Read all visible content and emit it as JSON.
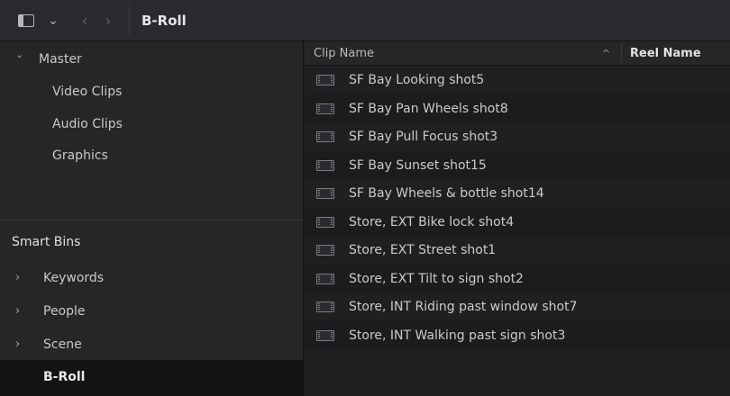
{
  "toolbar": {
    "panel_icon": "sidebar-panel-icon",
    "dropdown_icon": "chevron-down-icon",
    "back_glyph": "‹",
    "forward_glyph": "›",
    "dropdown_glyph": "⌄",
    "bin_title": "B-Roll"
  },
  "sidebar": {
    "master": {
      "label": "Master",
      "caret": "⌄",
      "children": [
        "Video Clips",
        "Audio Clips",
        "Graphics"
      ]
    },
    "smart_bins_title": "Smart Bins",
    "smart_bins": [
      {
        "label": "Keywords",
        "chevron": "›"
      },
      {
        "label": "People",
        "chevron": "›"
      },
      {
        "label": "Scene",
        "chevron": "›"
      }
    ],
    "selected_bin": "B-Roll"
  },
  "clip_list": {
    "columns": {
      "clip_name": "Clip Name",
      "sort_indicator": "^",
      "reel_name": "Reel Name"
    },
    "clips": [
      "SF Bay Looking shot5",
      "SF Bay Pan Wheels shot8",
      "SF Bay Pull Focus shot3",
      "SF Bay Sunset shot15",
      "SF Bay Wheels & bottle shot14",
      "Store, EXT Bike lock shot4",
      "Store, EXT Street shot1",
      "Store, EXT Tilt to sign shot2",
      "Store, INT Riding past window shot7",
      "Store, INT Walking past sign shot3"
    ]
  },
  "colors": {
    "background": "#1e1e21",
    "toolbar": "#2a2a2e",
    "sidebar": "#262629",
    "selected_row": "#141416",
    "text": "#c9c9cd"
  }
}
